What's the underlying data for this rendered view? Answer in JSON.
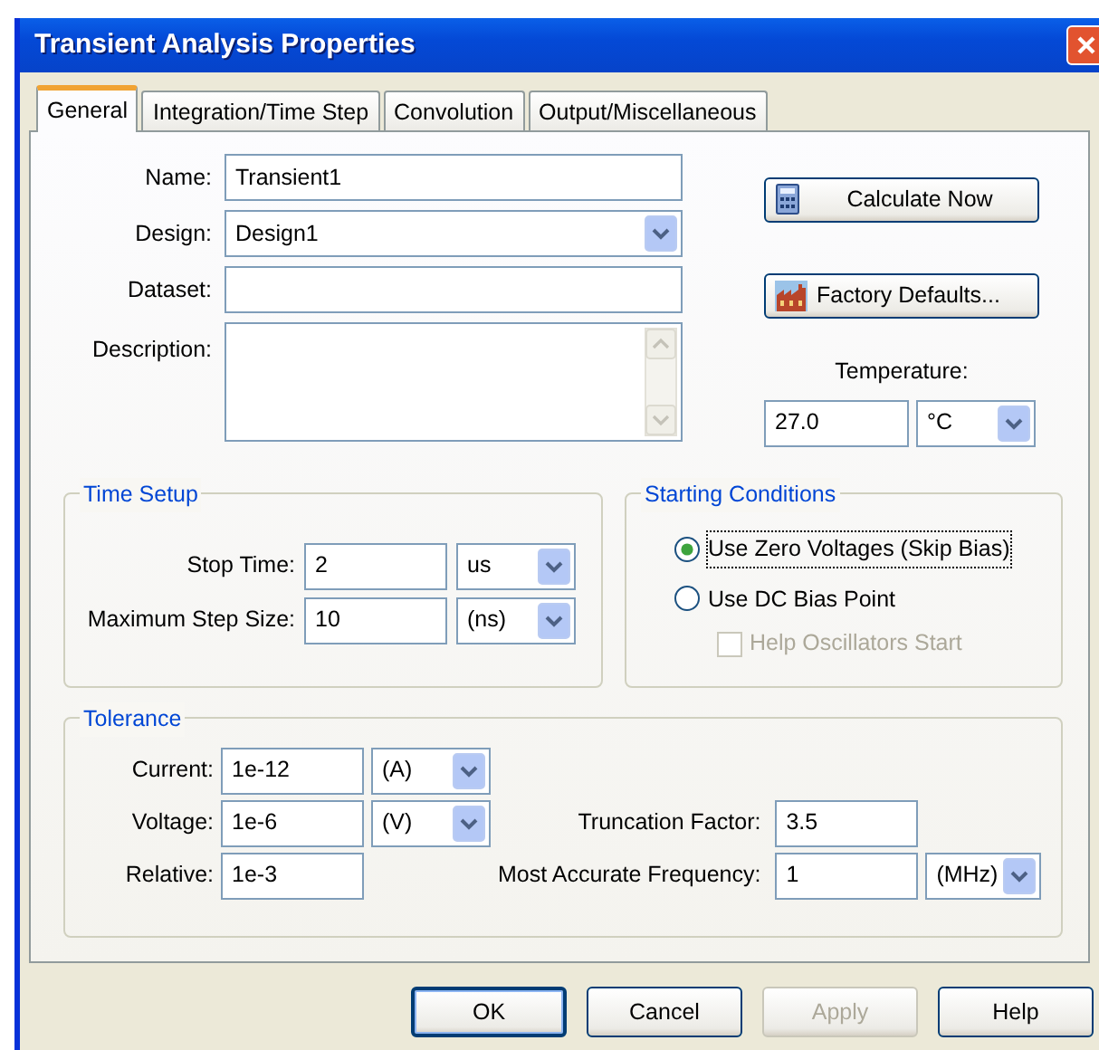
{
  "window": {
    "title": "Transient Analysis Properties"
  },
  "tabs": [
    {
      "label": "General",
      "selected": true
    },
    {
      "label": "Integration/Time Step",
      "selected": false
    },
    {
      "label": "Convolution",
      "selected": false
    },
    {
      "label": "Output/Miscellaneous",
      "selected": false
    }
  ],
  "general": {
    "fields": [
      {
        "kind": "text",
        "label": "Name:",
        "value": "Transient1"
      },
      {
        "kind": "select",
        "label": "Design:",
        "value": "Design1"
      },
      {
        "kind": "text",
        "label": "Dataset:"
      },
      {
        "kind": "textarea",
        "label": "Description:"
      }
    ],
    "buttons": [
      {
        "kind": "calculator",
        "label": "Calculate Now"
      },
      {
        "kind": "factory",
        "label": "Factory Defaults..."
      }
    ],
    "temperature": {
      "label": "Temperature:",
      "value": "27.0",
      "unit": "°C"
    }
  },
  "time_setup": {
    "title": "Time Setup",
    "rows": [
      {
        "label": "Stop Time:",
        "value": "2",
        "unit": "us"
      },
      {
        "label": "Maximum Step Size:",
        "value": "10",
        "unit": "(ns)"
      }
    ]
  },
  "starting_conditions": {
    "title": "Starting Conditions",
    "options": [
      {
        "kind": "radio",
        "label": "Use Zero Voltages (Skip Bias)",
        "selected": true,
        "disabled": false,
        "focused": true
      },
      {
        "kind": "radio",
        "label": "Use DC Bias Point",
        "selected": false,
        "disabled": false,
        "focused": false
      },
      {
        "kind": "checkbox",
        "label": "Help Oscillators Start",
        "checked": false,
        "disabled": true,
        "focused": false
      }
    ]
  },
  "tolerance": {
    "title": "Tolerance",
    "rows": [
      {
        "left": {
          "label": "Current:",
          "value": "1e-12",
          "unit": "(A)"
        }
      },
      {
        "left": {
          "label": "Voltage:",
          "value": "1e-6",
          "unit": "(V)"
        },
        "right": {
          "label": "Truncation Factor:",
          "value": "3.5"
        }
      },
      {
        "left": {
          "label": "Relative:",
          "value": "1e-3"
        },
        "right": {
          "label": "Most Accurate Frequency:",
          "value": "1",
          "unit": "(MHz)"
        }
      }
    ]
  },
  "footer_buttons": [
    {
      "label": "OK",
      "default": true,
      "disabled": false
    },
    {
      "label": "Cancel",
      "default": false,
      "disabled": false
    },
    {
      "label": "Apply",
      "default": false,
      "disabled": true
    },
    {
      "label": "Help",
      "default": false,
      "disabled": false
    }
  ]
}
